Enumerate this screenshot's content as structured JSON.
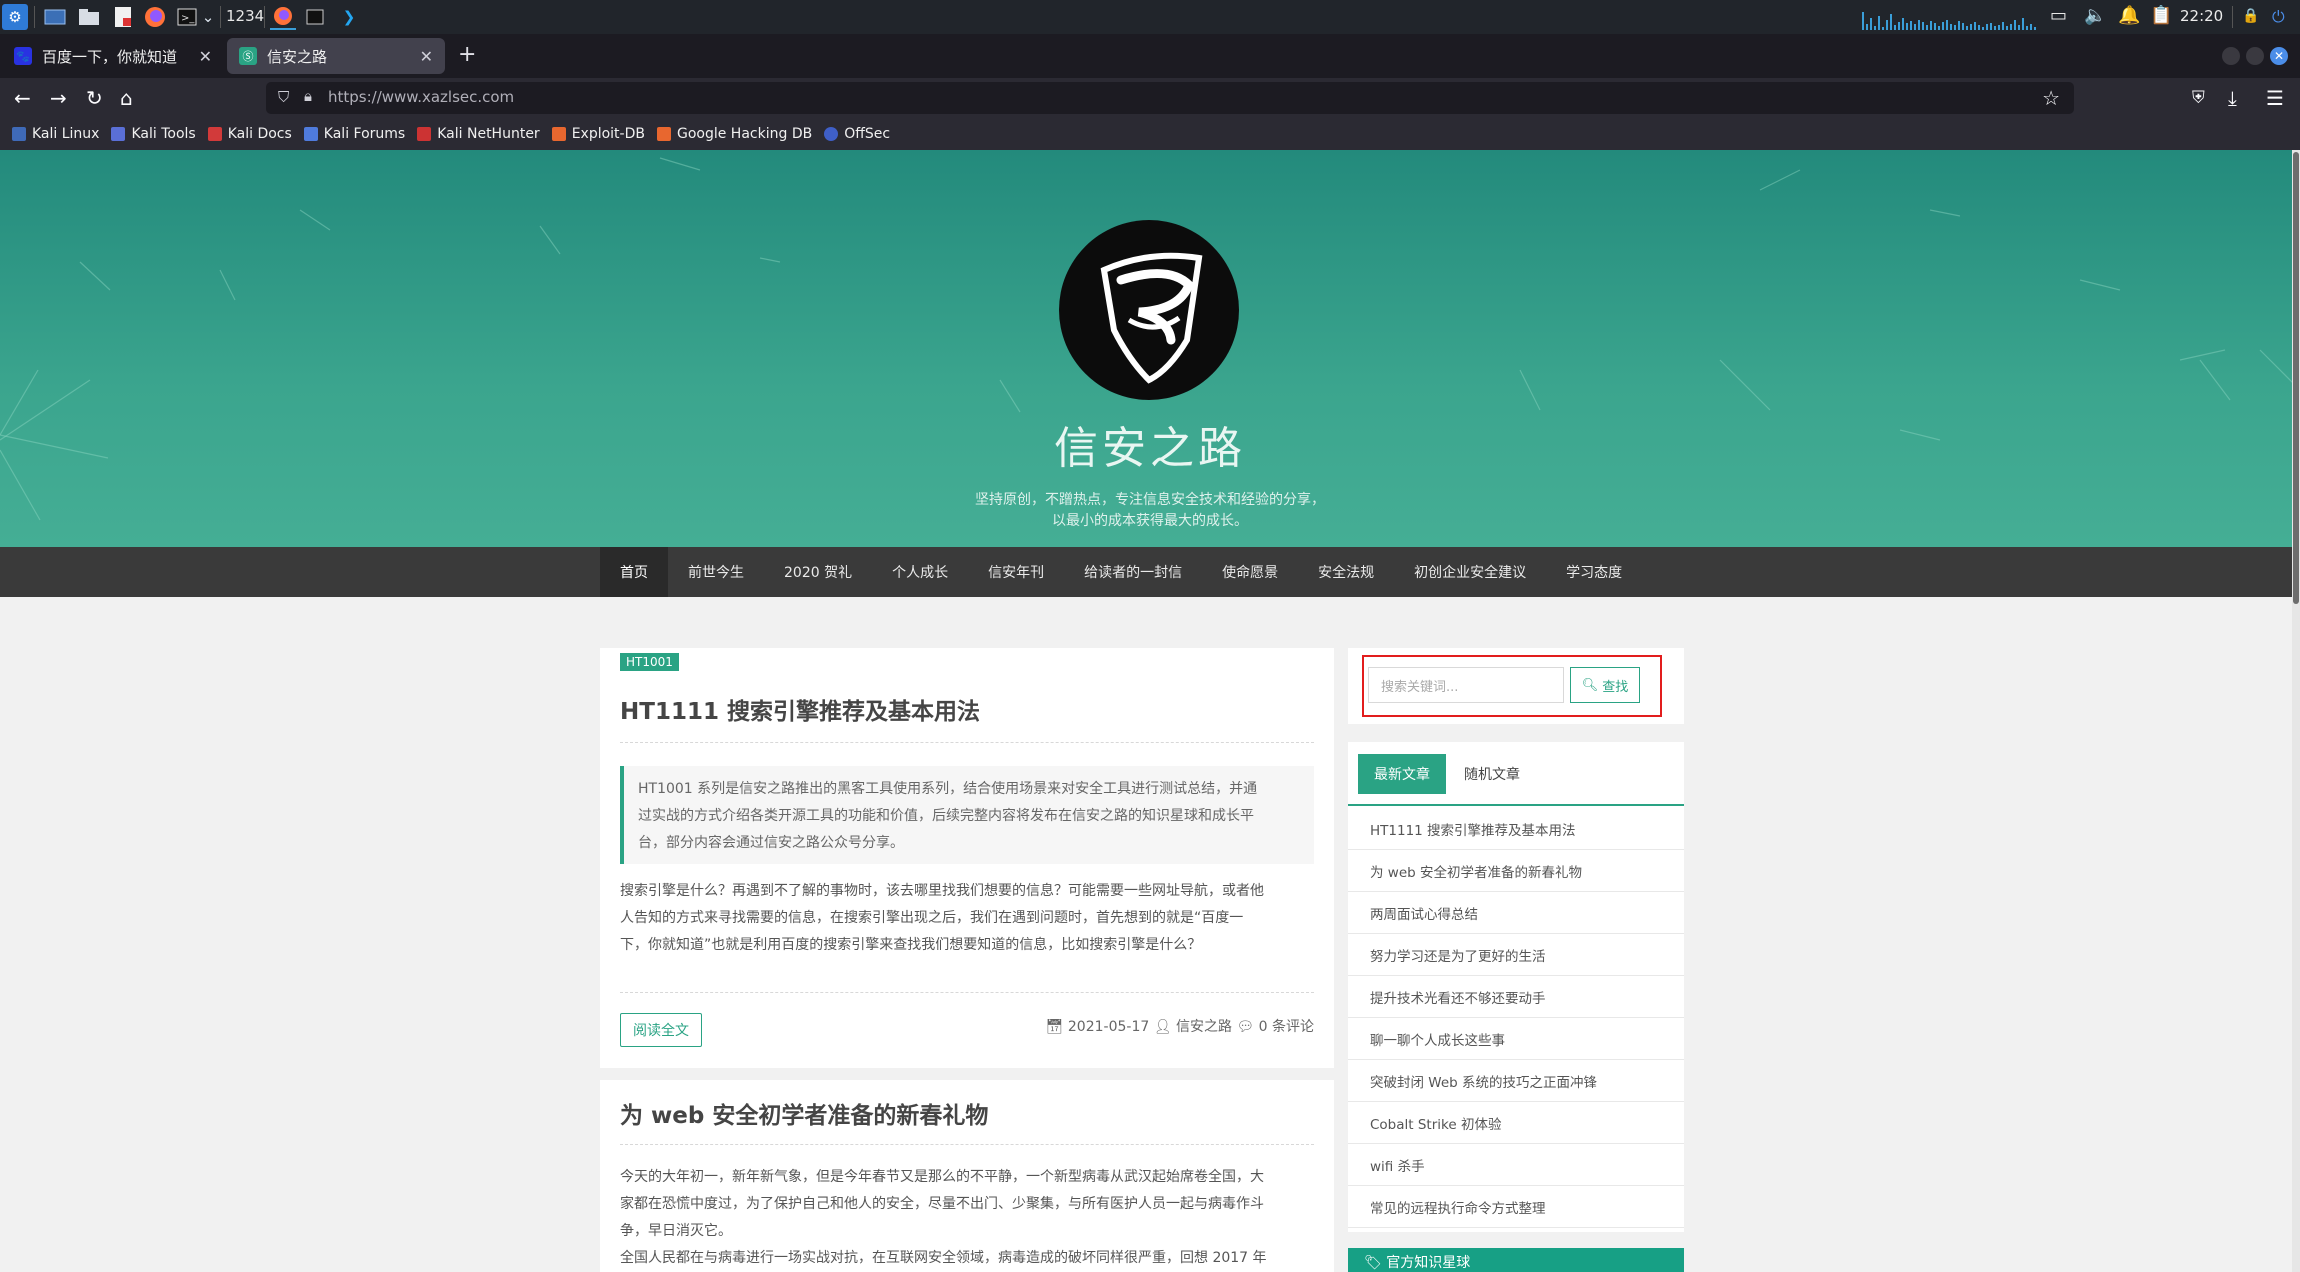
{
  "taskbar": {
    "workspace_label": "1234",
    "clock": "22:20",
    "icons": [
      "kali-menu-icon",
      "desktop-icon",
      "file-manager-icon",
      "text-editor-icon",
      "firefox-icon",
      "terminal-icon",
      "firefox-task-icon",
      "terminal-task-icon",
      "vscode-task-icon"
    ],
    "tray_icons": [
      "network-icon",
      "volume-icon",
      "bell-icon",
      "clipboard-icon",
      "lock-icon",
      "power-icon"
    ]
  },
  "browser": {
    "tabs": [
      {
        "label": "百度一下，你就知道",
        "active": false
      },
      {
        "label": "信安之路",
        "active": true
      }
    ],
    "url": "https://www.xazlsec.com",
    "bookmarks": [
      "Kali Linux",
      "Kali Tools",
      "Kali Docs",
      "Kali Forums",
      "Kali NetHunter",
      "Exploit-DB",
      "Google Hacking DB",
      "OffSec"
    ]
  },
  "site": {
    "title": "信安之路",
    "slogan_line1": "坚持原创，不蹭热点，专注信息安全技术和经验的分享，",
    "slogan_line2": "以最小的成本获得最大的成长。",
    "menu": [
      "首页",
      "前世今生",
      "2020 贺礼",
      "个人成长",
      "信安年刊",
      "给读者的一封信",
      "使命愿景",
      "安全法规",
      "初创企业安全建议",
      "学习态度"
    ],
    "colors": {
      "accent": "#2aa384",
      "hero": "#3ba58e",
      "menubar": "#3a3a3a"
    }
  },
  "posts": [
    {
      "tag": "HT1001",
      "title": "HT1111 搜索引擎推荐及基本用法",
      "quote_lines": [
        "HT1001 系列是信安之路推出的黑客工具使用系列，结合使用场景来对安全工具进行测试总结，并通",
        "过实战的方式介绍各类开源工具的功能和价值，后续完整内容将发布在信安之路的知识星球和成长平",
        "台，部分内容会通过信安之路公众号分享。"
      ],
      "body_lines": [
        "搜索引擎是什么？再遇到不了解的事物时，该去哪里找我们想要的信息？可能需要一些网址导航，或者他",
        "人告知的方式来寻找需要的信息，在搜索引擎出现之后，我们在遇到问题时，首先想到的就是“百度一",
        "下，你就知道”也就是利用百度的搜索引擎来查找我们想要知道的信息，比如搜索引擎是什么？"
      ],
      "read_more": "阅读全文",
      "date": "2021-05-17",
      "author": "信安之路",
      "comments": "0 条评论"
    },
    {
      "title": "为 web 安全初学者准备的新春礼物",
      "body_lines": [
        "今天的大年初一，新年新气象，但是今年春节又是那么的不平静，一个新型病毒从武汉起始席卷全国，大",
        "家都在恐慌中度过，为了保护自己和他人的安全，尽量不出门、少聚集，与所有医护人员一起与病毒作斗",
        "争，早日消灭它。",
        "全国人民都在与病毒进行一场实战对抗，在互联网安全领域，病毒造成的破坏同样很严重，回想 2017 年"
      ]
    }
  ],
  "sidebar": {
    "search_placeholder": "搜索关键词...",
    "search_button": "查找",
    "tab_latest": "最新文章",
    "tab_random": "随机文章",
    "recent": [
      "HT1111 搜索引擎推荐及基本用法",
      "为 web 安全初学者准备的新春礼物",
      "两周面试心得总结",
      "努力学习还是为了更好的生活",
      "提升技术光看还不够还要动手",
      "聊一聊个人成长这些事",
      "突破封闭 Web 系统的技巧之正面冲锋",
      "Cobalt Strike 初体验",
      "wifi 杀手",
      "常见的远程执行命令方式整理"
    ],
    "knowledge_header": "官方知识星球"
  }
}
